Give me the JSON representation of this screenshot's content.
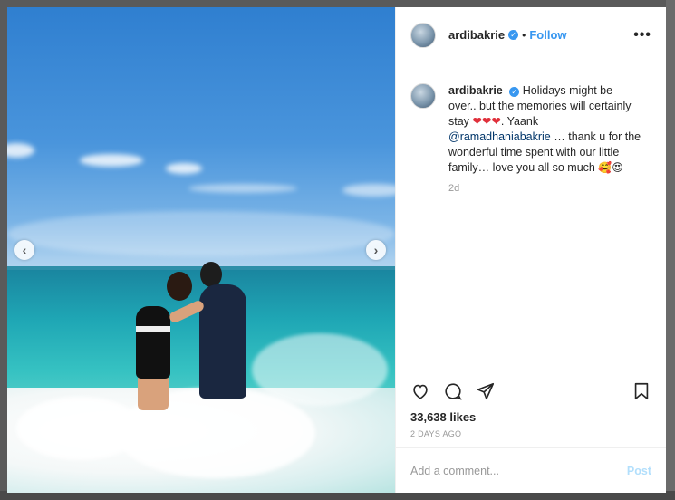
{
  "post": {
    "username": "ardibakrie",
    "follow_label": "Follow",
    "separator": "•",
    "more_label": "•••",
    "caption_part1": "Holidays might be over.. but the memories will certainly stay",
    "hearts": "❤❤❤",
    "caption_part2": ". Yaank",
    "mention": "@ramadhaniabakrie",
    "caption_part3": "… thank u for the wonderful time spent with our little family… love you all so much",
    "caption_emojis": "🥰😍",
    "relative_time": "2d",
    "likes": "33,638 likes",
    "posted_time": "2 DAYS AGO"
  },
  "comment": {
    "placeholder": "Add a comment...",
    "post_label": "Post"
  },
  "carousel": {
    "prev_label": "‹",
    "next_label": "›"
  },
  "icons": {
    "like": "heart-icon",
    "comment": "comment-icon",
    "share": "share-icon",
    "save": "bookmark-icon"
  },
  "colors": {
    "accent": "#3897f0",
    "post_disabled": "#b2dffc",
    "secondary_text": "#999999"
  }
}
